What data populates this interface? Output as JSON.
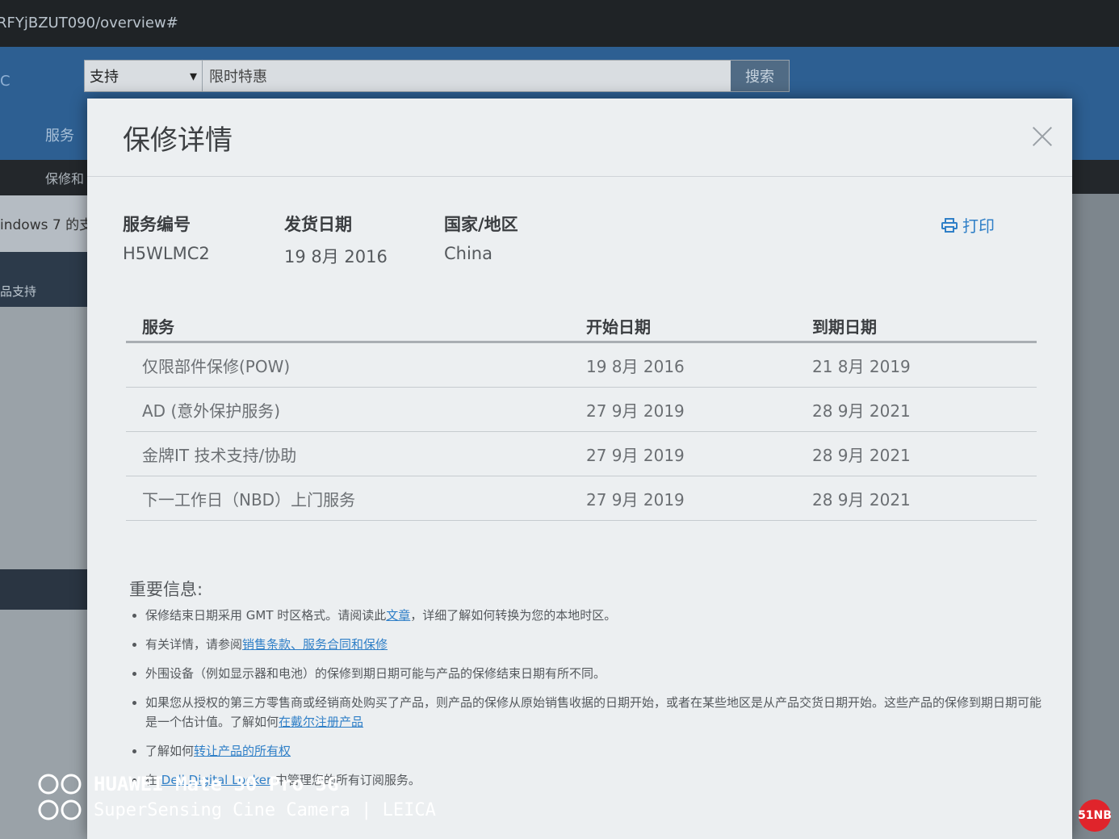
{
  "browser": {
    "url": "RFYjBZUT090/overview#"
  },
  "header": {
    "logo_fragment": "C",
    "search": {
      "category": "支持",
      "placeholder": "限时特惠",
      "button": "搜索"
    },
    "nav_fragment": "服务",
    "subnav_fragment": "保修和"
  },
  "page": {
    "notice_fragment": "indows 7 的支",
    "side_fragment": "品支持"
  },
  "modal": {
    "title": "保修详情",
    "print_label": "打印",
    "info": [
      {
        "label": "服务编号",
        "value": "H5WLMC2"
      },
      {
        "label": "发货日期",
        "value": "19 8月 2016"
      },
      {
        "label": "国家/地区",
        "value": "China"
      }
    ],
    "table": {
      "headers": [
        "服务",
        "开始日期",
        "到期日期"
      ],
      "rows": [
        [
          "仅限部件保修(POW)",
          "19 8月 2016",
          "21 8月 2019"
        ],
        [
          "AD (意外保护服务)",
          "27 9月 2019",
          "28 9月 2021"
        ],
        [
          "金牌IT 技术支持/协助",
          "27 9月 2019",
          "28 9月 2021"
        ],
        [
          "下一工作日（NBD）上门服务",
          "27 9月 2019",
          "28 9月 2021"
        ]
      ]
    },
    "important": {
      "title": "重要信息:",
      "items": [
        {
          "before": "保修结束日期采用 GMT 时区格式。请阅读此",
          "link": "文章",
          "after": "，详细了解如何转换为您的本地时区。"
        },
        {
          "before": "有关详情，请参阅",
          "link": "销售条款、服务合同和保修",
          "after": ""
        },
        {
          "before": "外围设备（例如显示器和电池）的保修到期日期可能与产品的保修结束日期有所不同。",
          "link": "",
          "after": ""
        },
        {
          "before": "如果您从授权的第三方零售商或经销商处购买了产品，则产品的保修从原始销售收据的日期开始，或者在某些地区是从产品交货日期开始。这些产品的保修到期日期可能是一个估计值。了解如何",
          "link": "在戴尔注册产品",
          "after": ""
        },
        {
          "before": "了解如何",
          "link": "转让产品的所有权",
          "after": ""
        },
        {
          "before": "在 ",
          "link": "Dell Digital Locker",
          "after": " 中管理您的所有订阅服务。"
        }
      ]
    }
  },
  "watermark": {
    "line1": "HUAWEI Mate 30 Pro 5G",
    "line2": "SuperSensing Cine Camera | LEICA",
    "badge": "51NB"
  },
  "colors": {
    "nav_blue": "#2d5f92",
    "link_blue": "#2f7fc7",
    "modal_bg": "#eceff1"
  }
}
